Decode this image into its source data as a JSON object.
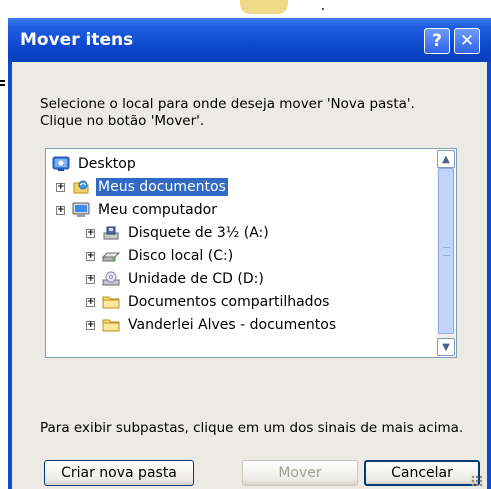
{
  "dialog": {
    "title": "Mover itens",
    "help_glyph": "?",
    "close_glyph": "✕"
  },
  "instructions": {
    "line1": "Selecione o local para onde deseja mover 'Nova pasta'.",
    "line2": "Clique no botão 'Mover'."
  },
  "tree": {
    "items": [
      {
        "label": "Desktop",
        "icon": "desktop-icon",
        "level": 0,
        "expander": ""
      },
      {
        "label": "Meus documentos",
        "icon": "my-documents-icon",
        "level": 1,
        "expander": "+",
        "selected": true
      },
      {
        "label": "Meu computador",
        "icon": "my-computer-icon",
        "level": 1,
        "expander": "+"
      },
      {
        "label": "Disquete de 3½ (A:)",
        "icon": "floppy-drive-icon",
        "level": 2,
        "expander": "+"
      },
      {
        "label": "Disco local (C:)",
        "icon": "hard-drive-icon",
        "level": 2,
        "expander": "+"
      },
      {
        "label": "Unidade de CD (D:)",
        "icon": "cd-drive-icon",
        "level": 2,
        "expander": "+"
      },
      {
        "label": "Documentos compartilhados",
        "icon": "folder-icon",
        "level": 2,
        "expander": "+"
      },
      {
        "label": "Vanderlei Alves - documentos",
        "icon": "folder-icon",
        "level": 2,
        "expander": "+"
      }
    ]
  },
  "hint": "Para exibir subpastas, clique em um dos sinais de mais acima.",
  "buttons": {
    "new_folder": "Criar nova pasta",
    "move": "Mover",
    "cancel": "Cancelar"
  },
  "colors": {
    "titlebar": "#0a4bd0",
    "selection": "#316ac5"
  }
}
